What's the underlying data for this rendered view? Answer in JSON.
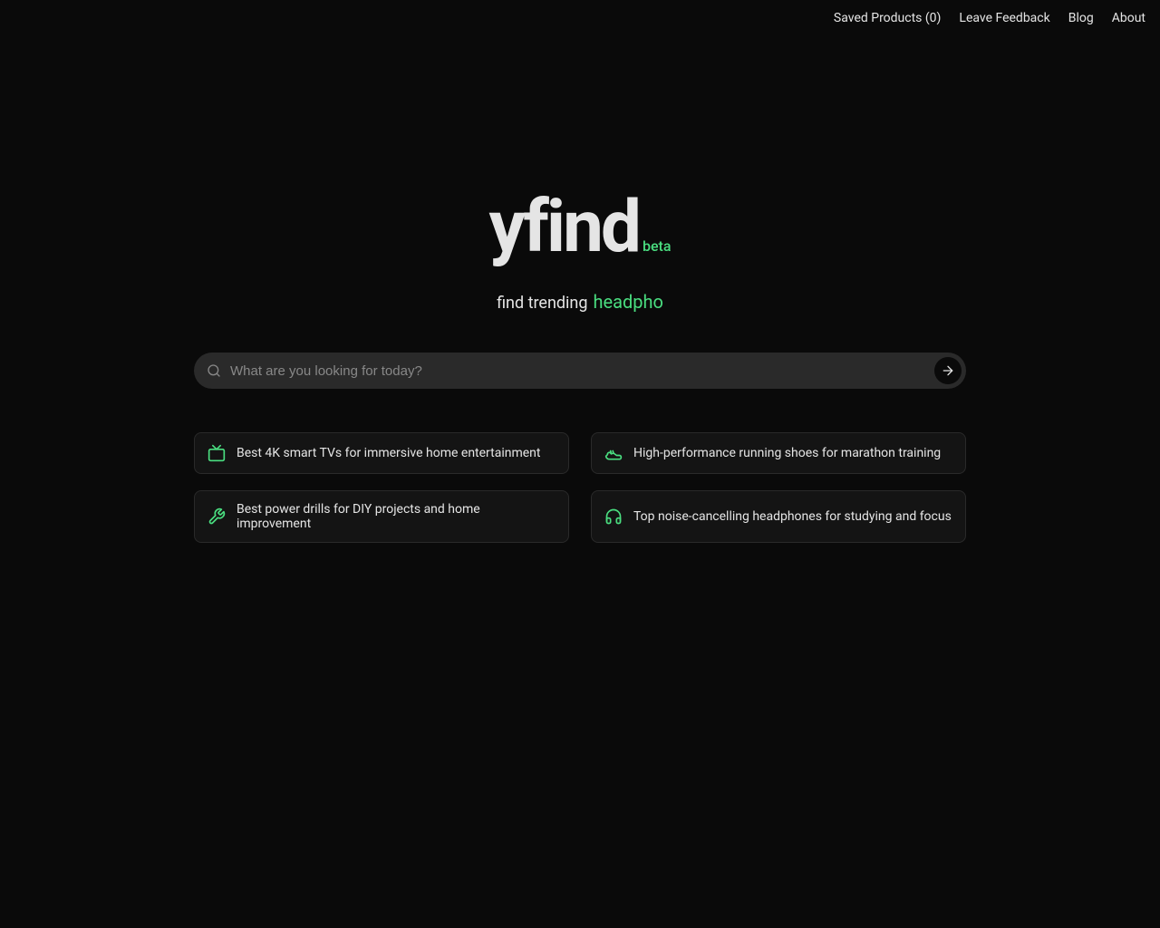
{
  "nav": {
    "saved_products": "Saved Products (0)",
    "leave_feedback": "Leave Feedback",
    "blog": "Blog",
    "about": "About"
  },
  "logo": {
    "text": "yfind",
    "badge": "beta"
  },
  "tagline": {
    "static": "find trending",
    "dynamic": "headpho"
  },
  "search": {
    "placeholder": "What are you looking for today?",
    "value": ""
  },
  "suggestions": [
    {
      "icon": "tv-icon",
      "text": "Best 4K smart TVs for immersive home entertainment"
    },
    {
      "icon": "shoe-icon",
      "text": "High-performance running shoes for marathon training"
    },
    {
      "icon": "wrench-icon",
      "text": "Best power drills for DIY projects and home improvement"
    },
    {
      "icon": "headphones-icon",
      "text": "Top noise-cancelling headphones for studying and focus"
    }
  ],
  "colors": {
    "accent": "#4ade80",
    "background": "#0a0a0a",
    "card": "#141414",
    "border": "#2a2a2a"
  }
}
